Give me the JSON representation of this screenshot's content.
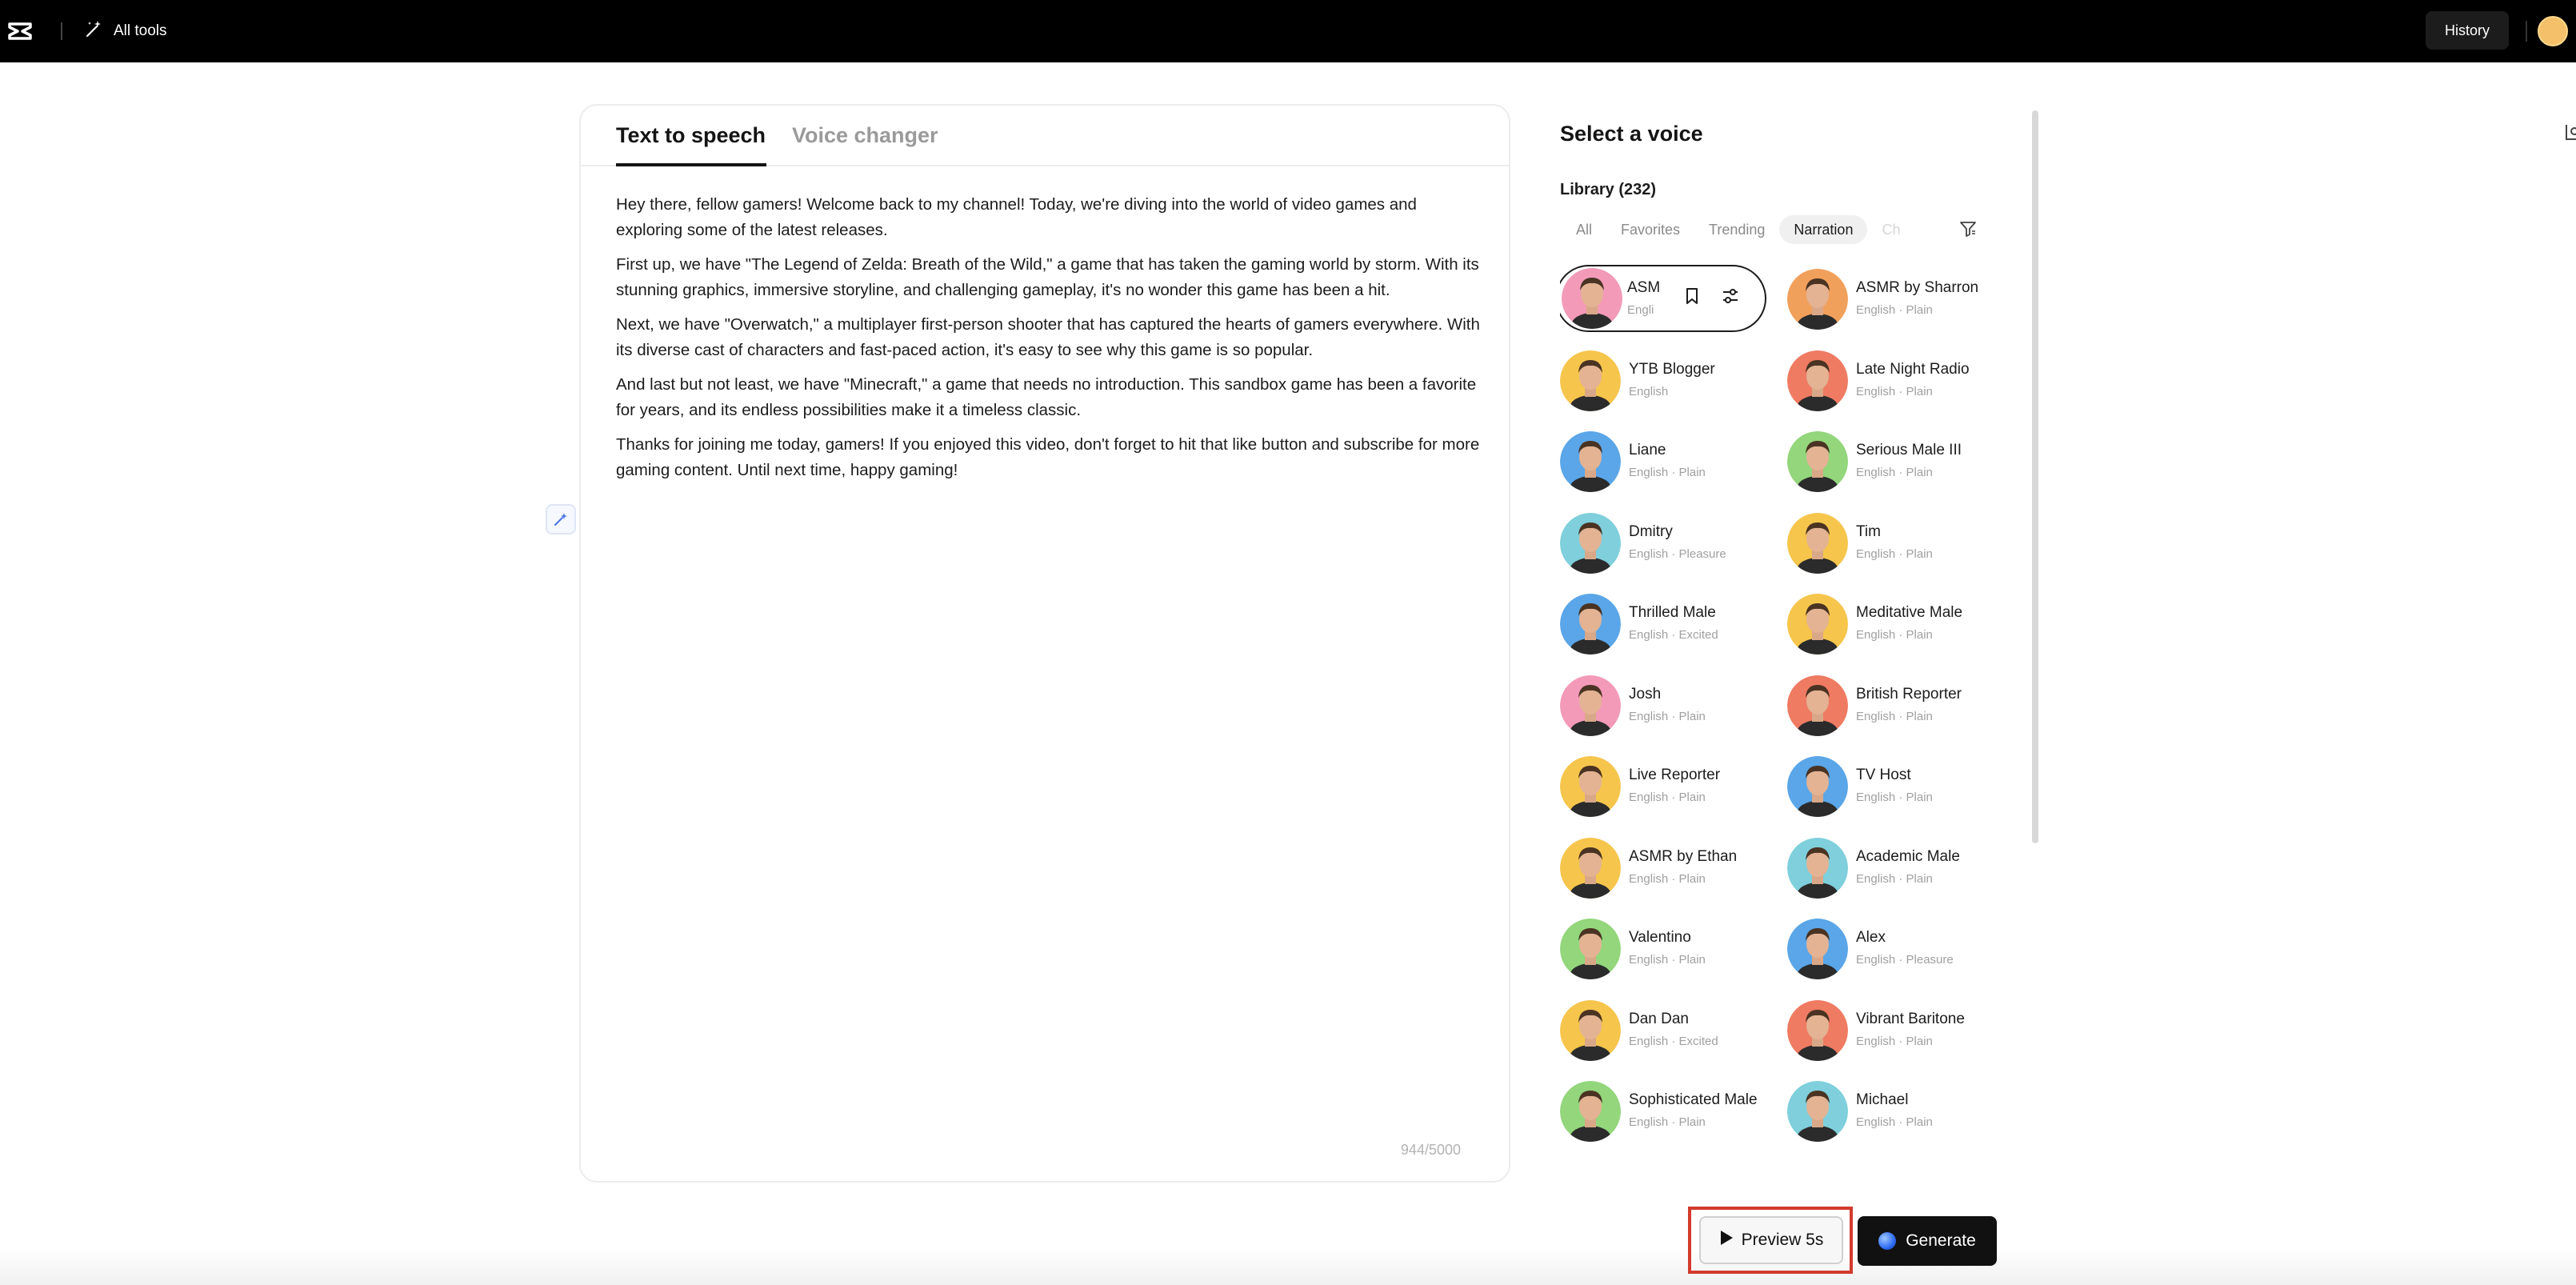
{
  "topbar": {
    "all_tools_label": "All tools",
    "history_label": "History"
  },
  "editor": {
    "tabs": [
      {
        "label": "Text to speech",
        "active": true
      },
      {
        "label": "Voice changer",
        "active": false
      }
    ],
    "paragraphs": [
      "Hey there, fellow gamers! Welcome back to my channel! Today, we're diving into the world of video games and exploring some of the latest releases.",
      "First up, we have \"The Legend of Zelda: Breath of the Wild,\" a game that has taken the gaming world by storm. With its stunning graphics, immersive storyline, and challenging gameplay, it's no wonder this game has been a hit.",
      "Next, we have \"Overwatch,\" a multiplayer first-person shooter that has captured the hearts of gamers everywhere. With its diverse cast of characters and fast-paced action, it's easy to see why this game is so popular.",
      "And last but not least, we have \"Minecraft,\" a game that needs no introduction. This sandbox game has been a favorite for years, and its endless possibilities make it a timeless classic.",
      "Thanks for joining me today, gamers! If you enjoyed this video, don't forget to hit that like button and subscribe for more gaming content. Until next time, happy gaming!"
    ],
    "char_count": "944/5000"
  },
  "voice_panel": {
    "title": "Select a voice",
    "library_label": "Library (232)",
    "filters": [
      "All",
      "Favorites",
      "Trending",
      "Narration",
      "Ch"
    ],
    "active_filter": "Narration",
    "voices": [
      {
        "name": "ASM",
        "meta": "Engli",
        "color": "#f39ab8",
        "selected": true
      },
      {
        "name": "ASMR by Sharron",
        "meta": "English · Plain",
        "color": "#f1a05c"
      },
      {
        "name": "YTB Blogger",
        "meta": "English",
        "color": "#f6c54c"
      },
      {
        "name": "Late Night Radio",
        "meta": "English · Plain",
        "color": "#ef7b62"
      },
      {
        "name": "Liane",
        "meta": "English · Plain",
        "color": "#5aa6e8"
      },
      {
        "name": "Serious Male III",
        "meta": "English · Plain",
        "color": "#93d67c"
      },
      {
        "name": "Dmitry",
        "meta": "English · Pleasure",
        "color": "#7fcfdc"
      },
      {
        "name": "Tim",
        "meta": "English · Plain",
        "color": "#f6c54c"
      },
      {
        "name": "Thrilled Male",
        "meta": "English · Excited",
        "color": "#5aa6e8"
      },
      {
        "name": "Meditative Male",
        "meta": "English · Plain",
        "color": "#f6c54c"
      },
      {
        "name": "Josh",
        "meta": "English · Plain",
        "color": "#f39ab8"
      },
      {
        "name": "British Reporter",
        "meta": "English · Plain",
        "color": "#ef7b62"
      },
      {
        "name": "Live Reporter",
        "meta": "English · Plain",
        "color": "#f6c54c"
      },
      {
        "name": "TV Host",
        "meta": "English · Plain",
        "color": "#5aa6e8"
      },
      {
        "name": "ASMR by Ethan",
        "meta": "English · Plain",
        "color": "#f6c54c"
      },
      {
        "name": "Academic Male",
        "meta": "English · Plain",
        "color": "#7fcfdc"
      },
      {
        "name": "Valentino",
        "meta": "English · Plain",
        "color": "#93d67c"
      },
      {
        "name": "Alex",
        "meta": "English · Pleasure",
        "color": "#5aa6e8"
      },
      {
        "name": "Dan Dan",
        "meta": "English · Excited",
        "color": "#f6c54c"
      },
      {
        "name": "Vibrant Baritone",
        "meta": "English · Plain",
        "color": "#ef7b62"
      },
      {
        "name": "Sophisticated Male",
        "meta": "English · Plain",
        "color": "#93d67c"
      },
      {
        "name": "Michael",
        "meta": "English · Plain",
        "color": "#7fcfdc"
      }
    ]
  },
  "actions": {
    "preview_label": "Preview 5s",
    "generate_label": "Generate"
  }
}
